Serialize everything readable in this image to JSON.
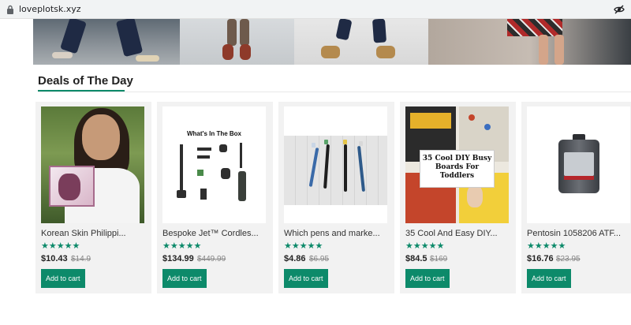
{
  "browser": {
    "url": "loveplotsk.xyz"
  },
  "section": {
    "title": "Deals of The Day"
  },
  "colors": {
    "accent": "#0d8a6a",
    "star": "#0d8a6a",
    "card_bg": "#f2f2f2"
  },
  "products": [
    {
      "title": "Korean Skin Philippi...",
      "rating": 5,
      "stars": "★★★★★",
      "price": "$10.43",
      "old_price": "$14.9",
      "button": "Add to cart"
    },
    {
      "title": "Bespoke Jet™ Cordles...",
      "rating": 5,
      "stars": "★★★★★",
      "price": "$134.99",
      "old_price": "$449.99",
      "button": "Add to cart",
      "image_text": "What's In The Box"
    },
    {
      "title": "Which pens and marke...",
      "rating": 5,
      "stars": "★★★★★",
      "price": "$4.86",
      "old_price": "$6.95",
      "button": "Add to cart"
    },
    {
      "title": "35 Cool And Easy DIY...",
      "rating": 5,
      "stars": "★★★★★",
      "price": "$84.5",
      "old_price": "$169",
      "button": "Add to cart",
      "image_text": "35 Cool DIY Busy Boards For Toddlers"
    },
    {
      "title": "Pentosin 1058206 ATF...",
      "rating": 5,
      "stars": "★★★★★",
      "price": "$16.76",
      "old_price": "$23.95",
      "button": "Add to cart"
    }
  ]
}
